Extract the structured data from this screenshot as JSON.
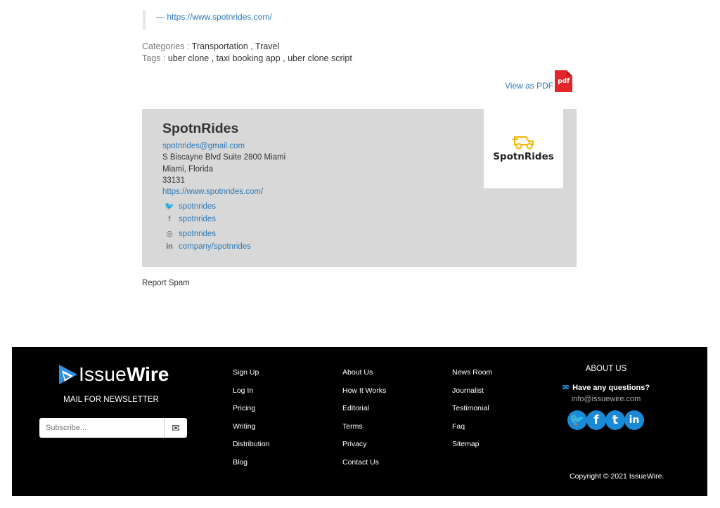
{
  "quote": {
    "link": "— https://www.spotnrides.com/"
  },
  "meta": {
    "categories_label": "Categories :",
    "categories": "Transportation , Travel",
    "tags_label": "Tags :",
    "tags": "uber clone , taxi booking app , uber clone script"
  },
  "pdf": {
    "label": "View as PDF",
    "icon_text": "pdf",
    "icon": "pdf-file-icon"
  },
  "company": {
    "name": "SpotnRides",
    "email": "spotnrides@gmail.com",
    "address1": "S Biscayne Blvd Suite 2800 Miami",
    "address2": "Miami, Florida",
    "zip": "33131",
    "website": "https://www.spotnrides.com/",
    "logo_text": "SpotnRides",
    "social": [
      {
        "icon": "twitter-icon",
        "glyph": "🐦",
        "label": "spotnrides"
      },
      {
        "icon": "facebook-icon",
        "glyph": "f",
        "label": "spotnrides"
      },
      {
        "icon": "instagram-icon",
        "glyph": "◎",
        "label": "spotnrides"
      },
      {
        "icon": "linkedin-icon",
        "glyph": "in",
        "label": "company/spotnrides"
      }
    ]
  },
  "report_spam": "Report Spam",
  "footer": {
    "brand_issue": "Issue",
    "brand_wire": "Wire",
    "newsletter_label": "MAIL FOR NEWSLETTER",
    "subscribe_placeholder": "Subscribe...",
    "col1": [
      "Sign Up",
      "Log In",
      "Pricing",
      "Writing",
      "Distribution",
      "Blog"
    ],
    "col2": [
      "About Us",
      "How It Works",
      "Editorial",
      "Terms",
      "Privacy",
      "Contact Us"
    ],
    "col3": [
      "News Room",
      "Journalist",
      "Testimonial",
      "Faq",
      "Sitemap"
    ],
    "about_title": "ABOUT US",
    "question": "Have any questions?",
    "email": "info@issuewire.com",
    "social_glyphs": [
      "🐦",
      "f",
      "t",
      "in"
    ],
    "copyright": "Copyright © 2021 IssueWire."
  },
  "colors": {
    "link": "#2f78b7",
    "card_bg": "#d8d8d8",
    "footer_bg": "#000000",
    "social_blue": "#1a8ad6",
    "pdf_red": "#e3262a",
    "logo_yellow": "#f5b400"
  }
}
